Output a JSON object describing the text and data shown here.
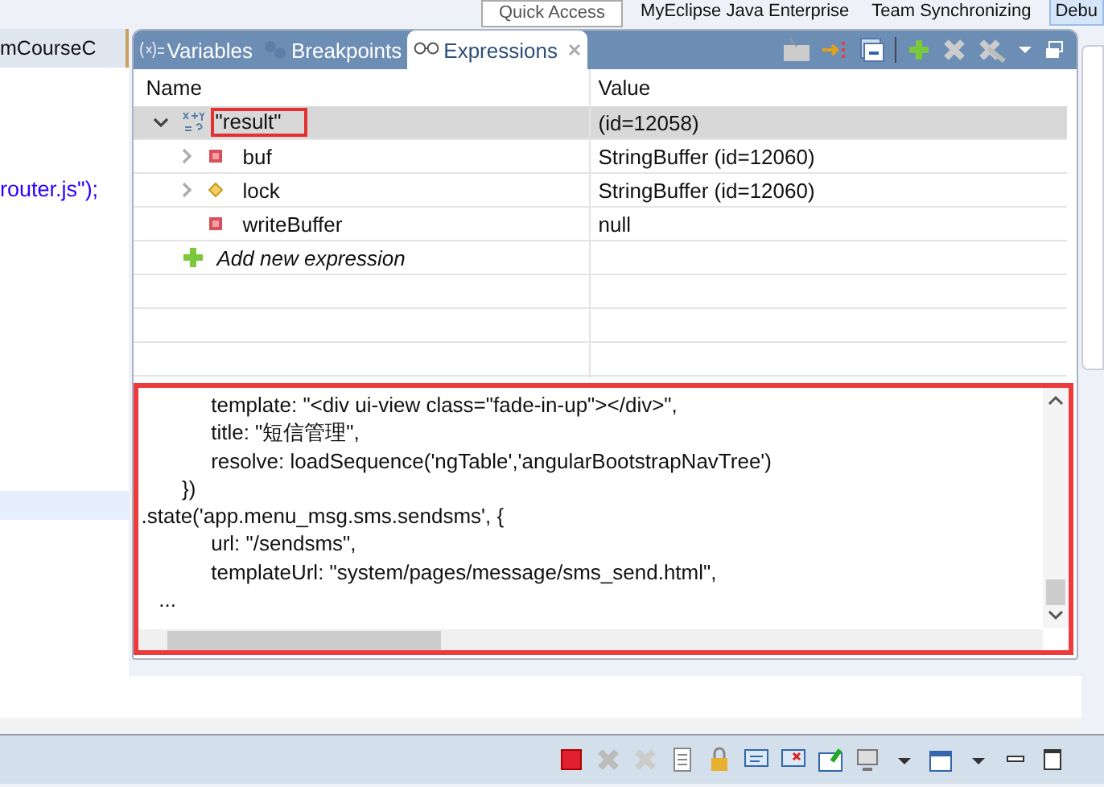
{
  "top_bar": {
    "quick_access": "Quick Access",
    "perspectives": [
      {
        "label": "MyEclipse Java Enterprise",
        "selected": false
      },
      {
        "label": "Team Synchronizing",
        "selected": false
      },
      {
        "label": "Debu",
        "selected": true
      }
    ]
  },
  "editor": {
    "tab": "mCourseC",
    "code_line": "router.js\");"
  },
  "view": {
    "tabs": [
      {
        "label": "Variables",
        "kind": "variables",
        "selected": false
      },
      {
        "label": "Breakpoints",
        "kind": "breakpoints",
        "selected": false
      },
      {
        "label": "Expressions",
        "kind": "expressions",
        "selected": true
      }
    ],
    "columns": [
      "Name",
      "Value"
    ],
    "rows": [
      {
        "name": "\"result\"",
        "value": " (id=12058)",
        "kind": "expression",
        "expanded": true,
        "selected": true,
        "children": [
          {
            "name": "buf",
            "value": "StringBuffer  (id=12060)",
            "kind": "private",
            "expanded": false,
            "selected": false
          },
          {
            "name": "lock",
            "value": "StringBuffer  (id=12060)",
            "kind": "package",
            "expanded": false,
            "selected": false
          },
          {
            "name": "writeBuffer",
            "value": "null",
            "kind": "private",
            "selected": false
          }
        ]
      },
      {
        "name": "Add new expression",
        "kind": "add",
        "selected": false
      }
    ],
    "details": [
      "            template: \"<div ui-view class=\"fade-in-up\"></div>\",",
      "            title: \"短信管理\",",
      "            resolve: loadSequence('ngTable','angularBootstrapNavTree')",
      "       })",
      ".state('app.menu_msg.sms.sendsms', {",
      "            url: \"/sendsms\",",
      "            templateUrl: \"system/pages/message/sms_send.html\",",
      "   ..."
    ]
  }
}
